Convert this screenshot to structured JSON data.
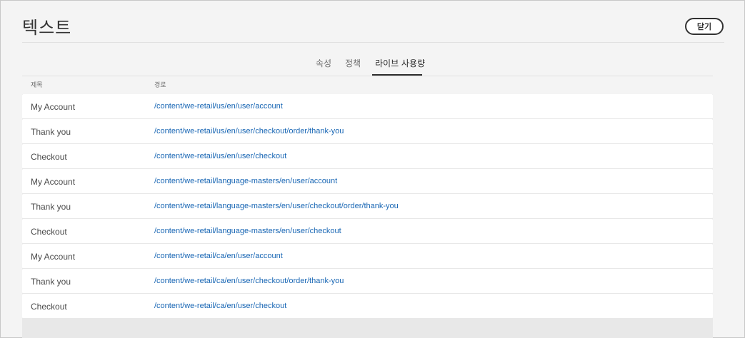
{
  "header": {
    "title": "텍스트",
    "close_label": "닫기"
  },
  "tabs": [
    {
      "label": "속성",
      "active": false
    },
    {
      "label": "정책",
      "active": false
    },
    {
      "label": "라이브 사용량",
      "active": true
    }
  ],
  "table": {
    "columns": [
      "제목",
      "경로"
    ],
    "rows": [
      {
        "title": "My Account",
        "path": "/content/we-retail/us/en/user/account"
      },
      {
        "title": "Thank you",
        "path": "/content/we-retail/us/en/user/checkout/order/thank-you"
      },
      {
        "title": "Checkout",
        "path": "/content/we-retail/us/en/user/checkout"
      },
      {
        "title": "My Account",
        "path": "/content/we-retail/language-masters/en/user/account"
      },
      {
        "title": "Thank you",
        "path": "/content/we-retail/language-masters/en/user/checkout/order/thank-you"
      },
      {
        "title": "Checkout",
        "path": "/content/we-retail/language-masters/en/user/checkout"
      },
      {
        "title": "My Account",
        "path": "/content/we-retail/ca/en/user/account"
      },
      {
        "title": "Thank you",
        "path": "/content/we-retail/ca/en/user/checkout/order/thank-you"
      },
      {
        "title": "Checkout",
        "path": "/content/we-retail/ca/en/user/checkout"
      }
    ]
  },
  "colors": {
    "link": "#1866b4",
    "background": "#f4f4f4",
    "active_tab": "#2c2c2c"
  }
}
